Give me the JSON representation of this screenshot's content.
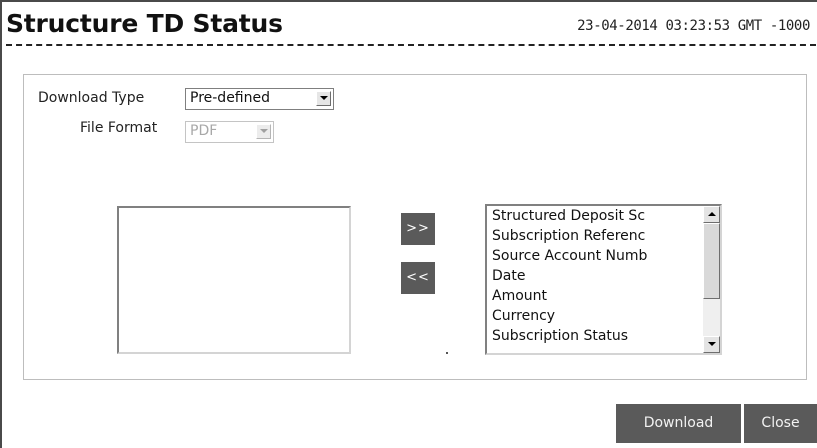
{
  "header": {
    "title": "Structure TD Status",
    "timestamp": "23-04-2014 03:23:53 GMT -1000"
  },
  "form": {
    "download_type": {
      "label": "Download Type",
      "value": "Pre-defined"
    },
    "file_format": {
      "label": "File Format",
      "value": "PDF",
      "disabled": true
    }
  },
  "columns": {
    "move_right_label": ">>",
    "move_left_label": "<<",
    "available": [],
    "selected": [
      "Structured Deposit Sc",
      "Subscription Referenc",
      "Source Account Numb",
      "Date",
      "Amount",
      "Currency",
      "Subscription Status"
    ]
  },
  "actions": {
    "download_label": "Download",
    "close_label": "Close"
  },
  "colors": {
    "button_bg": "#5a5a5a",
    "button_text": "#ffffff"
  }
}
